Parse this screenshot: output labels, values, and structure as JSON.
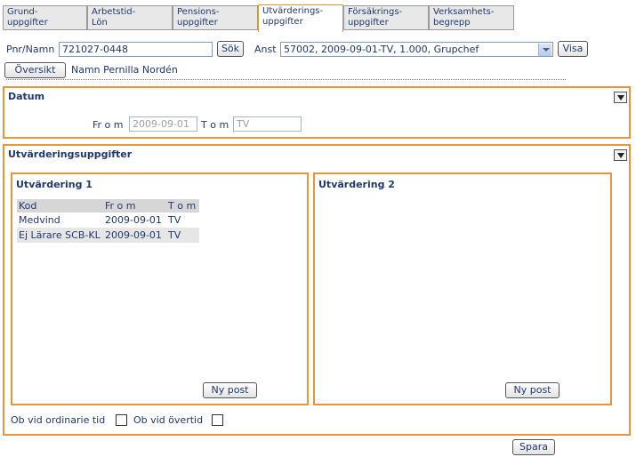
{
  "tabs": [
    {
      "line1": "Grund-",
      "line2": "uppgifter"
    },
    {
      "line1": "Arbetstid-",
      "line2": "Lön"
    },
    {
      "line1": "Pensions-",
      "line2": "uppgifter"
    },
    {
      "line1": "Utvärderings-",
      "line2": "uppgifter"
    },
    {
      "line1": "Försäkrings-",
      "line2": "uppgifter"
    },
    {
      "line1": "Verksamhets-",
      "line2": "begrepp"
    }
  ],
  "search": {
    "pnr_label": "Pnr/Namn",
    "pnr_value": "721027-0448",
    "search_button": "Sök",
    "anst_label": "Anst",
    "anst_value": "57002, 2009-09-01-TV, 1.000, Grupchef",
    "show_button": "Visa"
  },
  "overview": {
    "button": "Översikt",
    "name_text": "Namn Pernilla Nordén"
  },
  "datum": {
    "title": "Datum",
    "from_label": "Fr o m",
    "from_value": "2009-09-01",
    "to_label": "T o m",
    "to_value": "TV"
  },
  "evaluations": {
    "title": "Utvärderingsuppgifter",
    "eval1": {
      "title": "Utvärdering 1",
      "columns": [
        "Kod",
        "Fr o m",
        "T o m"
      ],
      "rows": [
        [
          "Medvind",
          "2009-09-01",
          "TV"
        ],
        [
          "Ej Lärare SCB-KL",
          "2009-09-01",
          "TV"
        ]
      ],
      "new_button": "Ny post"
    },
    "eval2": {
      "title": "Utvärdering 2",
      "new_button": "Ny post"
    },
    "ob_ordinary_label": "Ob vid ordinarie tid",
    "ob_overtime_label": "Ob vid övertid"
  },
  "save_button": "Spara",
  "colors": {
    "panel_border": "#e8953a",
    "text": "#1f3a6e"
  }
}
